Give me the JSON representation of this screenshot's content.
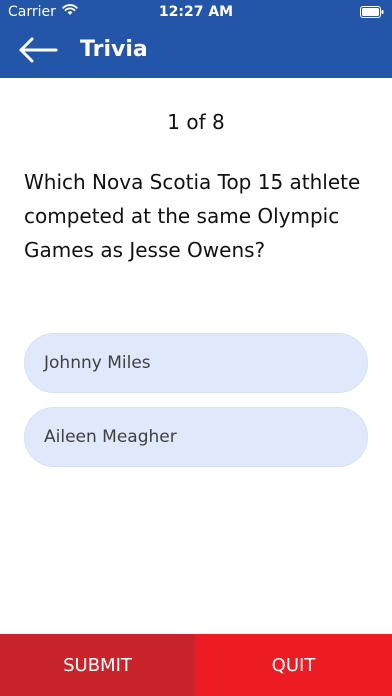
{
  "status_bar": {
    "carrier": "Carrier",
    "time": "12:27 AM"
  },
  "nav": {
    "title": "Trivia",
    "back_icon": "arrow-left-icon"
  },
  "quiz": {
    "counter": "1 of 8",
    "question": "Which Nova Scotia Top 15 athlete competed at the same Olympic Games as Jesse Owens?",
    "answers": [
      {
        "label": "Johnny Miles"
      },
      {
        "label": "Aileen Meagher"
      }
    ]
  },
  "buttons": {
    "submit": "SUBMIT",
    "quit": "QUIT"
  },
  "colors": {
    "header": "#2356a8",
    "answer_bg": "#dfe9fb",
    "submit_bg": "#c9232b",
    "quit_bg": "#ed1c24"
  }
}
